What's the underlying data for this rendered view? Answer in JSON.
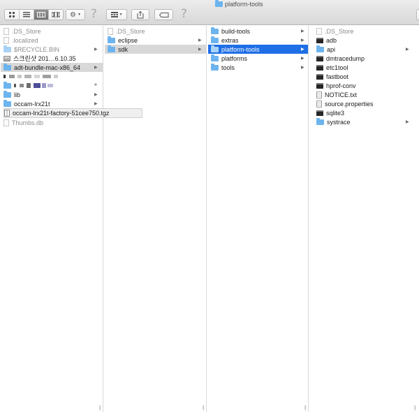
{
  "window": {
    "title": "platform-tools",
    "title_icon": "folder-icon"
  },
  "toolbar": {
    "view_modes": [
      "icon-view",
      "list-view",
      "column-view",
      "cover-flow-view"
    ],
    "active_view": "column-view",
    "action_icon": "gear-icon",
    "arrange_icon": "arrange-grid-icon",
    "share_icon": "share-icon",
    "tag_icon": "tag-icon",
    "help_glyph": "?"
  },
  "columns": [
    {
      "items": [
        {
          "name": ".DS_Store",
          "icon": "document-icon",
          "dim": true
        },
        {
          "name": ".localized",
          "icon": "document-icon",
          "dim": true
        },
        {
          "name": "$RECYCLE.BIN",
          "icon": "folder-icon",
          "dim": true,
          "arrow": true
        },
        {
          "name": "스크린샷 201…6.10.35",
          "icon": "image-icon"
        },
        {
          "name": "adt-bundle-mac-x86_64",
          "icon": "folder-icon",
          "arrow": true,
          "highlight": "gray"
        },
        {
          "name": "",
          "icon": "pixelated-icon"
        },
        {
          "name": "",
          "icon": "folder-icon",
          "arrow": true
        },
        {
          "name": "lib",
          "icon": "folder-icon",
          "arrow": true
        },
        {
          "name": "occam-lrx21t",
          "icon": "folder-icon",
          "arrow": true
        },
        {
          "name": "occam-lrx21t-factory-51cee750.tgz",
          "icon": "archive-icon"
        },
        {
          "name": "Thumbs.db",
          "icon": "document-icon",
          "dim": true
        }
      ]
    },
    {
      "items": [
        {
          "name": ".DS_Store",
          "icon": "document-icon",
          "dim": true
        },
        {
          "name": "eclipse",
          "icon": "folder-icon",
          "arrow": true
        },
        {
          "name": "sdk",
          "icon": "folder-icon",
          "arrow": true,
          "highlight": "gray"
        }
      ]
    },
    {
      "items": [
        {
          "name": "build-tools",
          "icon": "folder-icon",
          "arrow": true
        },
        {
          "name": "extras",
          "icon": "folder-icon",
          "arrow": true
        },
        {
          "name": "platform-tools",
          "icon": "folder-icon",
          "arrow": true,
          "highlight": "blue"
        },
        {
          "name": "platforms",
          "icon": "folder-icon",
          "arrow": true
        },
        {
          "name": "tools",
          "icon": "folder-icon",
          "arrow": true
        }
      ]
    },
    {
      "items": [
        {
          "name": ".DS_Store",
          "icon": "document-icon",
          "dim": true
        },
        {
          "name": "adb",
          "icon": "executable-icon"
        },
        {
          "name": "api",
          "icon": "folder-icon",
          "arrow": true
        },
        {
          "name": "dmtracedump",
          "icon": "executable-icon"
        },
        {
          "name": "etc1tool",
          "icon": "executable-icon"
        },
        {
          "name": "fastboot",
          "icon": "executable-icon"
        },
        {
          "name": "hprof-conv",
          "icon": "executable-icon"
        },
        {
          "name": "NOTICE.txt",
          "icon": "text-file-icon"
        },
        {
          "name": "source.properties",
          "icon": "text-file-icon"
        },
        {
          "name": "sqlite3",
          "icon": "executable-icon"
        },
        {
          "name": "systrace",
          "icon": "folder-icon",
          "arrow": true
        }
      ]
    }
  ]
}
